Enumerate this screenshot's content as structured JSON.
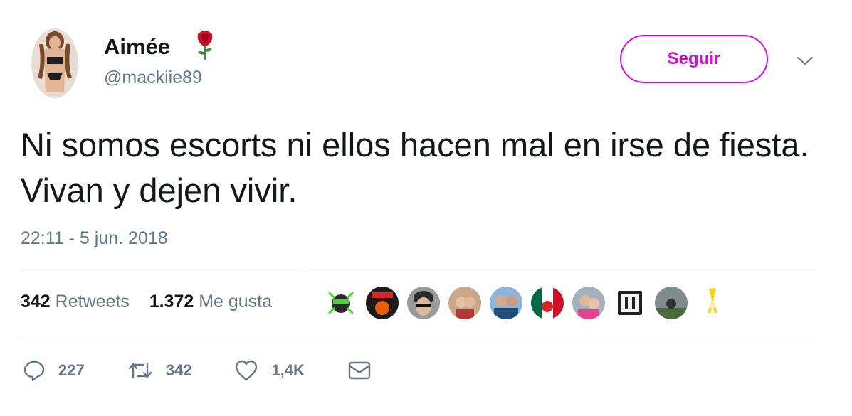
{
  "profile": {
    "name": "Aimée",
    "handle": "@mackiie89",
    "follow_label": "Seguir",
    "emoji": "rose-icon"
  },
  "tweet": {
    "text": "Ni somos escorts ni ellos hacen mal en irse de fiesta. Vivan y dejen vivir.",
    "timestamp": "22:11 - 5 jun. 2018"
  },
  "stats": {
    "retweets_count": "342",
    "retweets_label": "Retweets",
    "likes_count": "1.372",
    "likes_label": "Me gusta"
  },
  "actions": {
    "replies": "227",
    "retweets": "342",
    "likes": "1,4K"
  },
  "colors": {
    "accent": "#d10fd8",
    "muted": "#657786",
    "text": "#14171a"
  }
}
